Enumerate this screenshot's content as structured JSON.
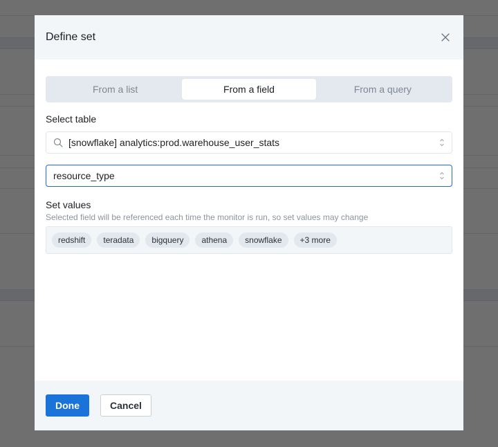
{
  "modal": {
    "title": "Define set",
    "close_icon": "close-icon"
  },
  "tabs": [
    {
      "label": "From a list",
      "active": false
    },
    {
      "label": "From a field",
      "active": true
    },
    {
      "label": "From a query",
      "active": false
    }
  ],
  "select_table": {
    "label": "Select table",
    "value": "[snowflake] analytics:prod.warehouse_user_stats",
    "icon": "search-icon"
  },
  "field_select": {
    "value": "resource_type"
  },
  "set_values": {
    "title": "Set values",
    "description": "Selected field will be referenced each time the monitor is run, so set values may change",
    "chips": [
      "redshift",
      "teradata",
      "bigquery",
      "athena",
      "snowflake",
      "+3 more"
    ]
  },
  "footer": {
    "done_label": "Done",
    "cancel_label": "Cancel"
  },
  "colors": {
    "primary": "#1a73d9",
    "focus_border": "#1f6fc5",
    "header_bg": "#f3f6f9",
    "overlay": "#6f6f6f"
  }
}
